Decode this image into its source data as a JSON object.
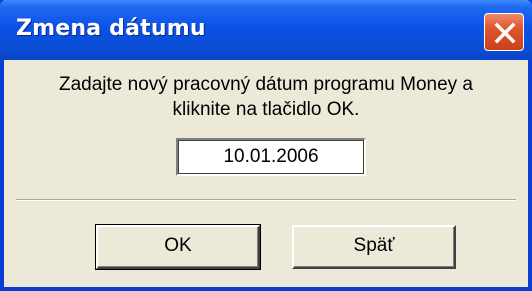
{
  "window": {
    "title": "Zmena dátumu",
    "close_icon": "close-icon"
  },
  "dialog": {
    "message_line1": "Zadajte nový pracovný dátum programu Money a",
    "message_line2": "kliknite na tlačidlo OK.",
    "date_value": "10.01.2006"
  },
  "buttons": {
    "ok_label": "OK",
    "back_label": "Späť"
  },
  "colors": {
    "titlebar": "#0a52e6",
    "dialog_bg": "#ece9d8",
    "close_button": "#e0552e"
  }
}
